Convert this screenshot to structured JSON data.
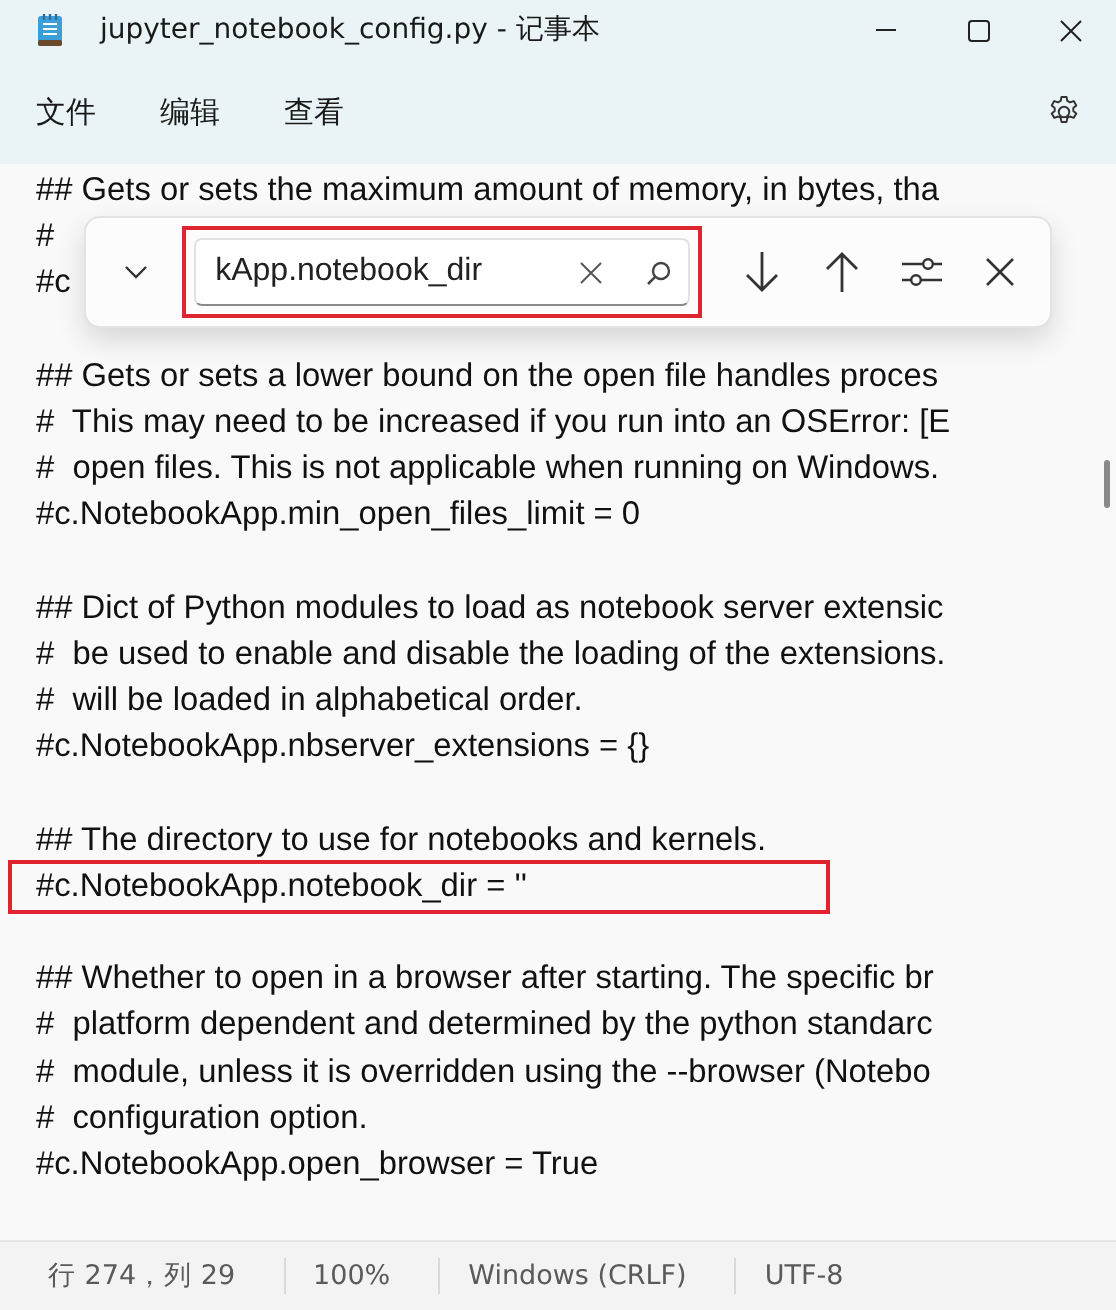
{
  "window": {
    "title": "jupyter_notebook_config.py - 记事本"
  },
  "menu": [
    "文件",
    "编辑",
    "查看"
  ],
  "find_bar": {
    "value": "kApp.notebook_dir",
    "highlighted": true
  },
  "editor": {
    "blocks": [
      {
        "lines": [
          {
            "text": "## Gets or sets the maximum amount of memory, in bytes, tha",
            "highlighted": false
          },
          {
            "text": "#",
            "highlighted": false
          },
          {
            "text": "#c",
            "highlighted": false
          }
        ]
      },
      {
        "lines": [
          {
            "text": "## Gets or sets a lower bound on the open file handles proces",
            "highlighted": false
          },
          {
            "text": "#  This may need to be increased if you run into an OSError: [E",
            "highlighted": false
          },
          {
            "text": "#  open files. This is not applicable when running on Windows.",
            "highlighted": false
          },
          {
            "text": "#c.NotebookApp.min_open_files_limit = 0",
            "highlighted": false
          }
        ]
      },
      {
        "lines": [
          {
            "text": "## Dict of Python modules to load as notebook server extensic",
            "highlighted": false
          },
          {
            "text": "#  be used to enable and disable the loading of the extensions.",
            "highlighted": false
          },
          {
            "text": "#  will be loaded in alphabetical order.",
            "highlighted": false
          },
          {
            "text": "#c.NotebookApp.nbserver_extensions = {}",
            "highlighted": false
          }
        ]
      },
      {
        "lines": [
          {
            "text": "## The directory to use for notebooks and kernels.",
            "highlighted": false
          },
          {
            "text": "#c.NotebookApp.notebook_dir = ''",
            "highlighted": true
          }
        ]
      },
      {
        "lines": [
          {
            "text": "## Whether to open in a browser after starting. The specific br",
            "highlighted": false
          },
          {
            "text": "#  platform dependent and determined by the python standarc",
            "highlighted": false
          },
          {
            "text": "#  module, unless it is overridden using the --browser (Notebo",
            "highlighted": false
          },
          {
            "text": "#  configuration option.",
            "highlighted": false
          },
          {
            "text": "#c.NotebookApp.open_browser = True",
            "highlighted": false
          }
        ]
      }
    ]
  },
  "status_bar": [
    "行 274，列 29",
    "100%",
    "Windows (CRLF)",
    "UTF-8"
  ]
}
